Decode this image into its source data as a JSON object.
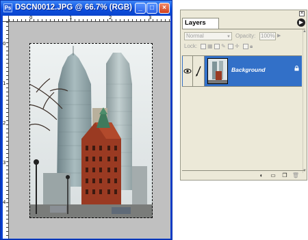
{
  "document_window": {
    "title": "DSCN0012.JPG @ 66.7% (RGB)",
    "buttons": {
      "minimize": "_",
      "maximize": "□",
      "close": "×"
    },
    "ruler_numbers_h": [
      "0",
      "1",
      "2",
      "3"
    ],
    "ruler_numbers_v": [
      "0",
      "1",
      "2",
      "3",
      "4",
      "5"
    ]
  },
  "layers_panel": {
    "tab_label": "Layers",
    "blend_mode": "Normal",
    "opacity_label": "Opacity:",
    "opacity_value": "100%",
    "lock_label": "Lock:",
    "layers": [
      {
        "name": "Background",
        "selected": true,
        "visible": true,
        "locked": true
      }
    ]
  },
  "colors": {
    "titlebar": "#0c4fe0",
    "selection": "#3270c8",
    "panel_bg": "#ece9d8",
    "canvas_bg": "#c0c0c0"
  }
}
